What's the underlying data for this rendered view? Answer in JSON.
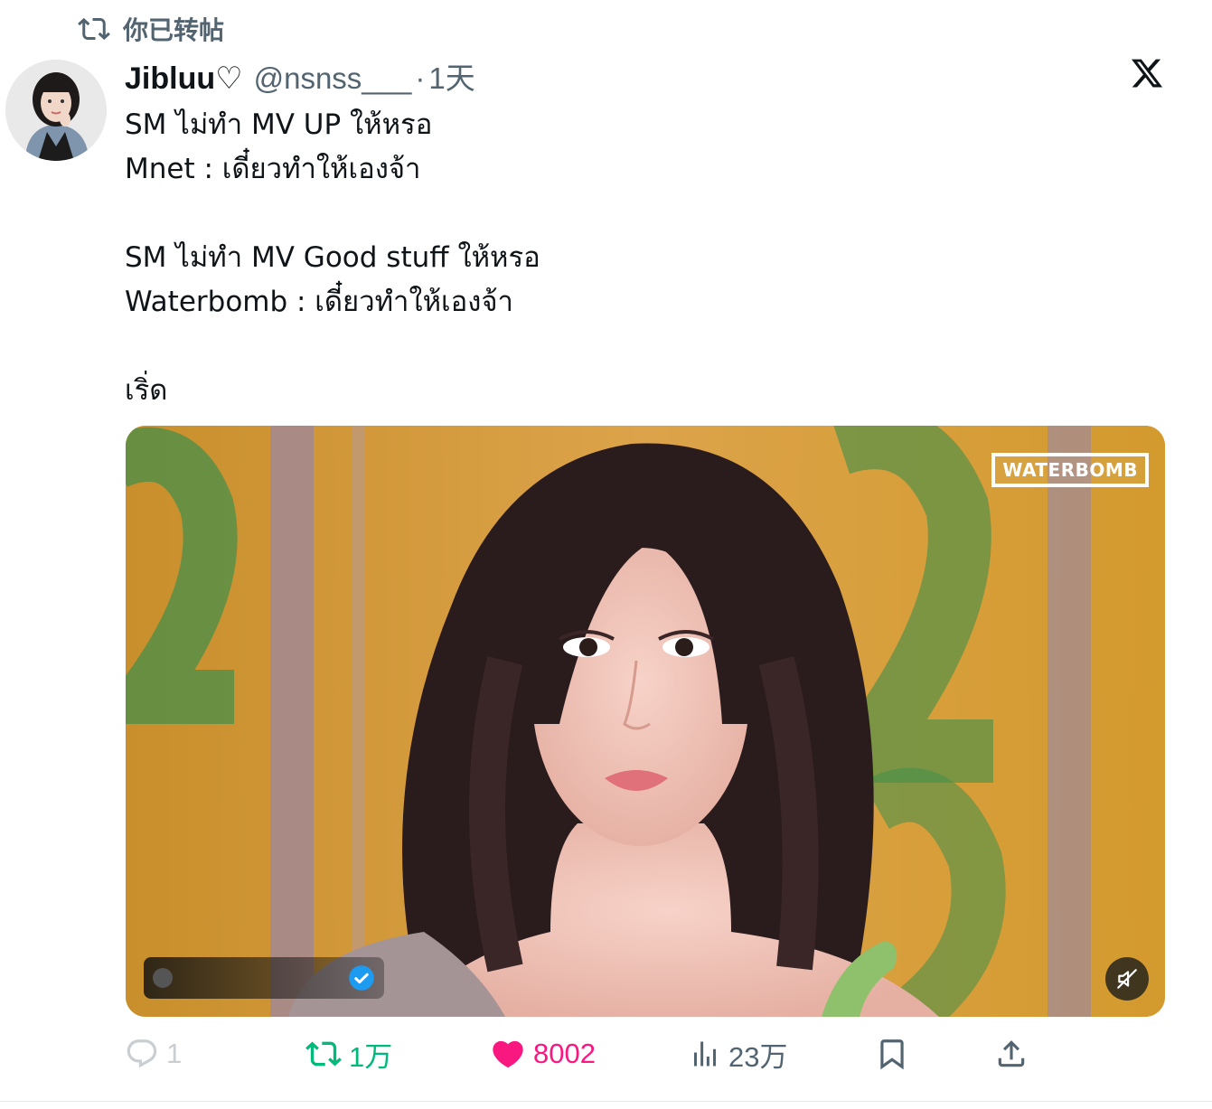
{
  "retweet_header": {
    "label": "你已转帖"
  },
  "author": {
    "display_name": "Jibluu♡",
    "handle": "@nsnss___",
    "separator": "·",
    "time": "1天"
  },
  "tweet": {
    "lines": [
      "SM ไม่ทำ MV UP ให้หรอ",
      "Mnet : เดี๋ยวทำให้เองจ้า",
      "",
      "SM ไม่ทำ MV Good stuff ให้หรอ",
      "Waterbomb : เดี๋ยวทำให้เองจ้า",
      "",
      "เริ่ด"
    ]
  },
  "media": {
    "watermark": "WATERBOMB",
    "verified_icon": "verified-badge-icon",
    "mute_icon": "muted-speaker-icon"
  },
  "actions": {
    "reply_count": "1",
    "retweet_count": "1万",
    "like_count": "8002",
    "views_count": "23万"
  },
  "colors": {
    "retweet_active": "#00ba7c",
    "like_active": "#f91880",
    "muted_text": "#536471",
    "verified": "#1d9bf0"
  }
}
